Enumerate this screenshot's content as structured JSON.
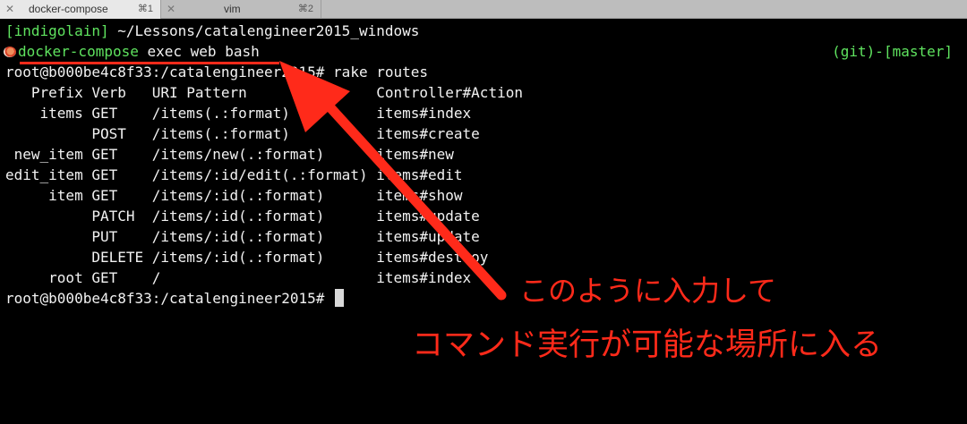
{
  "tabs": [
    {
      "title": "docker-compose",
      "shortcut": "⌘1",
      "close": "✕",
      "active": true
    },
    {
      "title": "vim",
      "shortcut": "⌘2",
      "close": "✕",
      "active": false
    }
  ],
  "terminal": {
    "line1": {
      "user": "[indigolain]",
      "path": " ~/Lessons/catalengineer2015_windows"
    },
    "line2": {
      "command_name": "docker-compose",
      "args": " exec web bash"
    },
    "git_status": "(git)-[master]",
    "lines": [
      "root@b000be4c8f33:/catalengineer2015# rake routes",
      "   Prefix Verb   URI Pattern               Controller#Action",
      "    items GET    /items(.:format)          items#index",
      "          POST   /items(.:format)          items#create",
      " new_item GET    /items/new(.:format)      items#new",
      "edit_item GET    /items/:id/edit(.:format) items#edit",
      "     item GET    /items/:id(.:format)      items#show",
      "          PATCH  /items/:id(.:format)      items#update",
      "          PUT    /items/:id(.:format)      items#update",
      "          DELETE /items/:id(.:format)      items#destroy",
      "     root GET    /                         items#index"
    ],
    "prompt": "root@b000be4c8f33:/catalengineer2015# "
  },
  "annotation": {
    "line1": "このように入力して",
    "line2": "コマンド実行が可能な場所に入る",
    "color": "#ff2a1a"
  },
  "icons": {
    "prompt_icon": "sushi-icon",
    "close": "close-icon"
  }
}
